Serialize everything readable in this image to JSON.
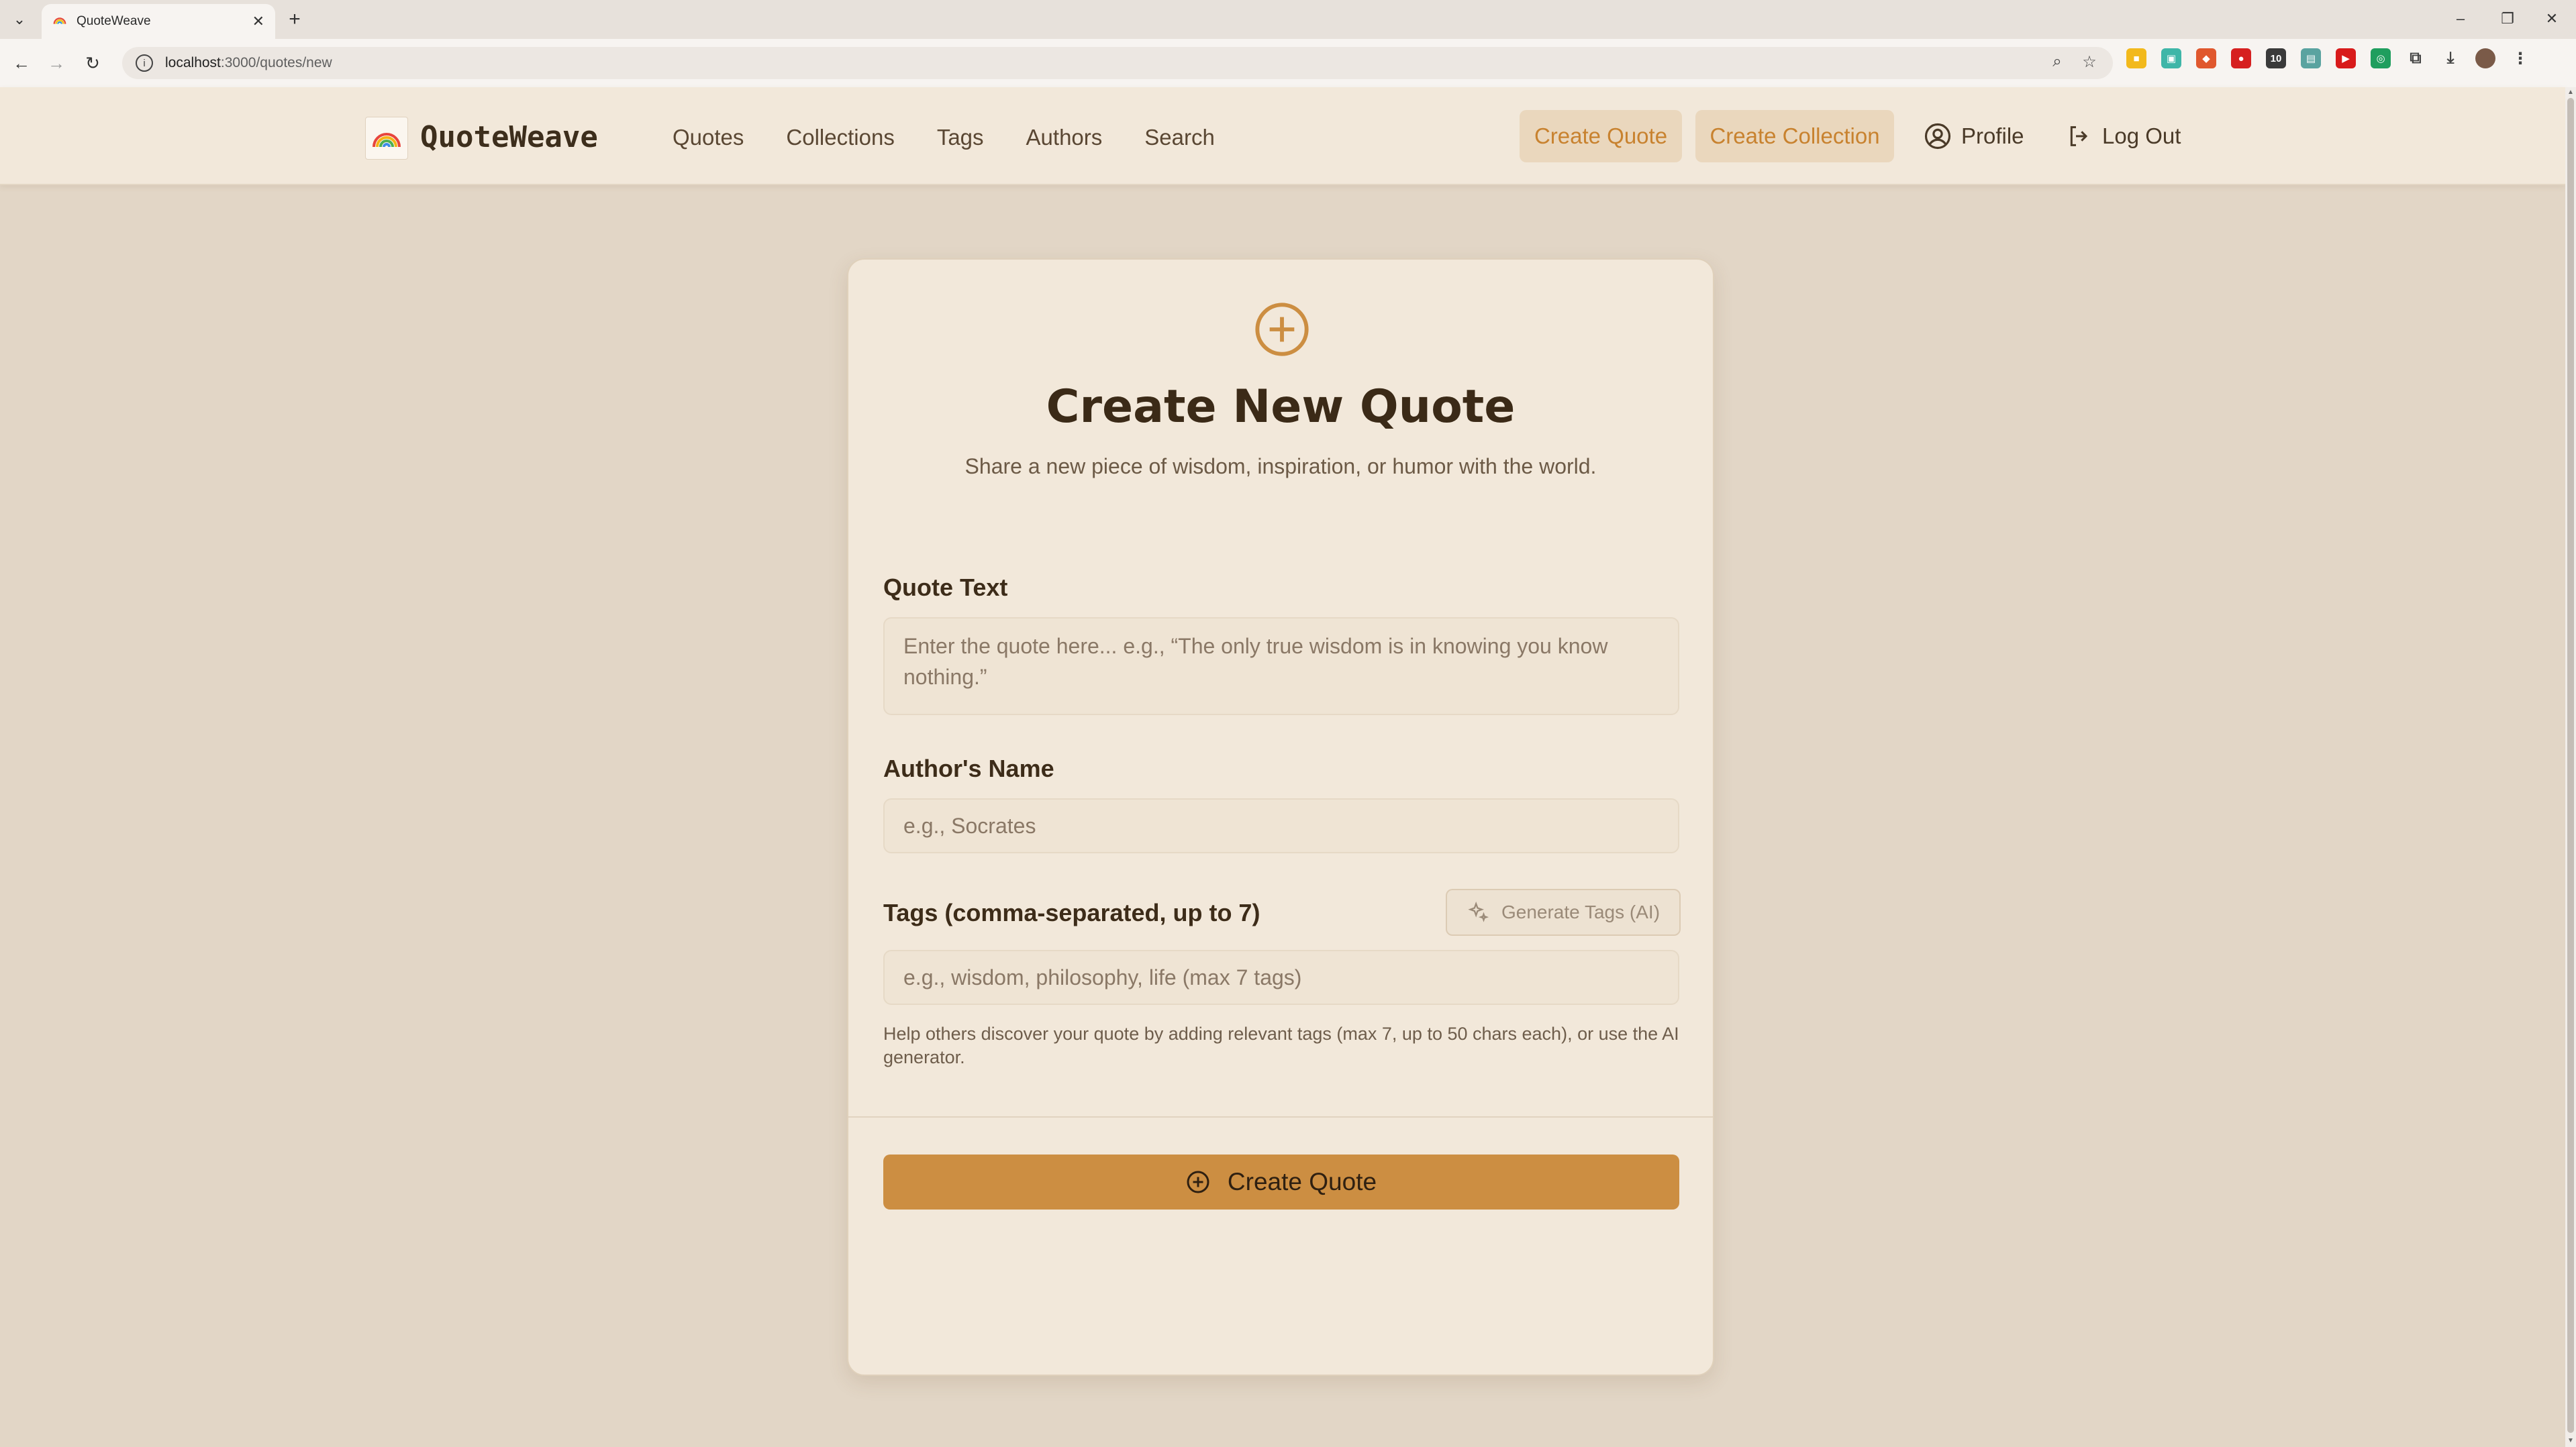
{
  "browser": {
    "tab_title": "QuoteWeave",
    "url_host": "localhost",
    "url_path": ":3000/quotes/new"
  },
  "header": {
    "logo_text": "QuoteWeave",
    "nav": [
      "Quotes",
      "Collections",
      "Tags",
      "Authors",
      "Search"
    ],
    "create_quote_label": "Create Quote",
    "create_collection_label": "Create Collection",
    "profile_label": "Profile",
    "logout_label": "Log Out"
  },
  "form": {
    "title": "Create New Quote",
    "subtitle": "Share a new piece of wisdom, inspiration, or humor with the world.",
    "quote_text_label": "Quote Text",
    "quote_text_placeholder": "Enter the quote here... e.g., “The only true wisdom is in knowing you know nothing.”",
    "author_label": "Author's Name",
    "author_placeholder": "e.g., Socrates",
    "tags_label": "Tags (comma-separated, up to 7)",
    "generate_tags_label": "Generate Tags (AI)",
    "tags_placeholder": "e.g., wisdom, philosophy, life (max 7 tags)",
    "tags_help": "Help others discover your quote by adding relevant tags (max 7, up to 50 chars each), or use the AI generator.",
    "submit_label": "Create Quote"
  },
  "colors": {
    "accent": "#cc8e42",
    "background": "#e2d6c6",
    "card": "#f2e8da",
    "text": "#3b2a17"
  }
}
